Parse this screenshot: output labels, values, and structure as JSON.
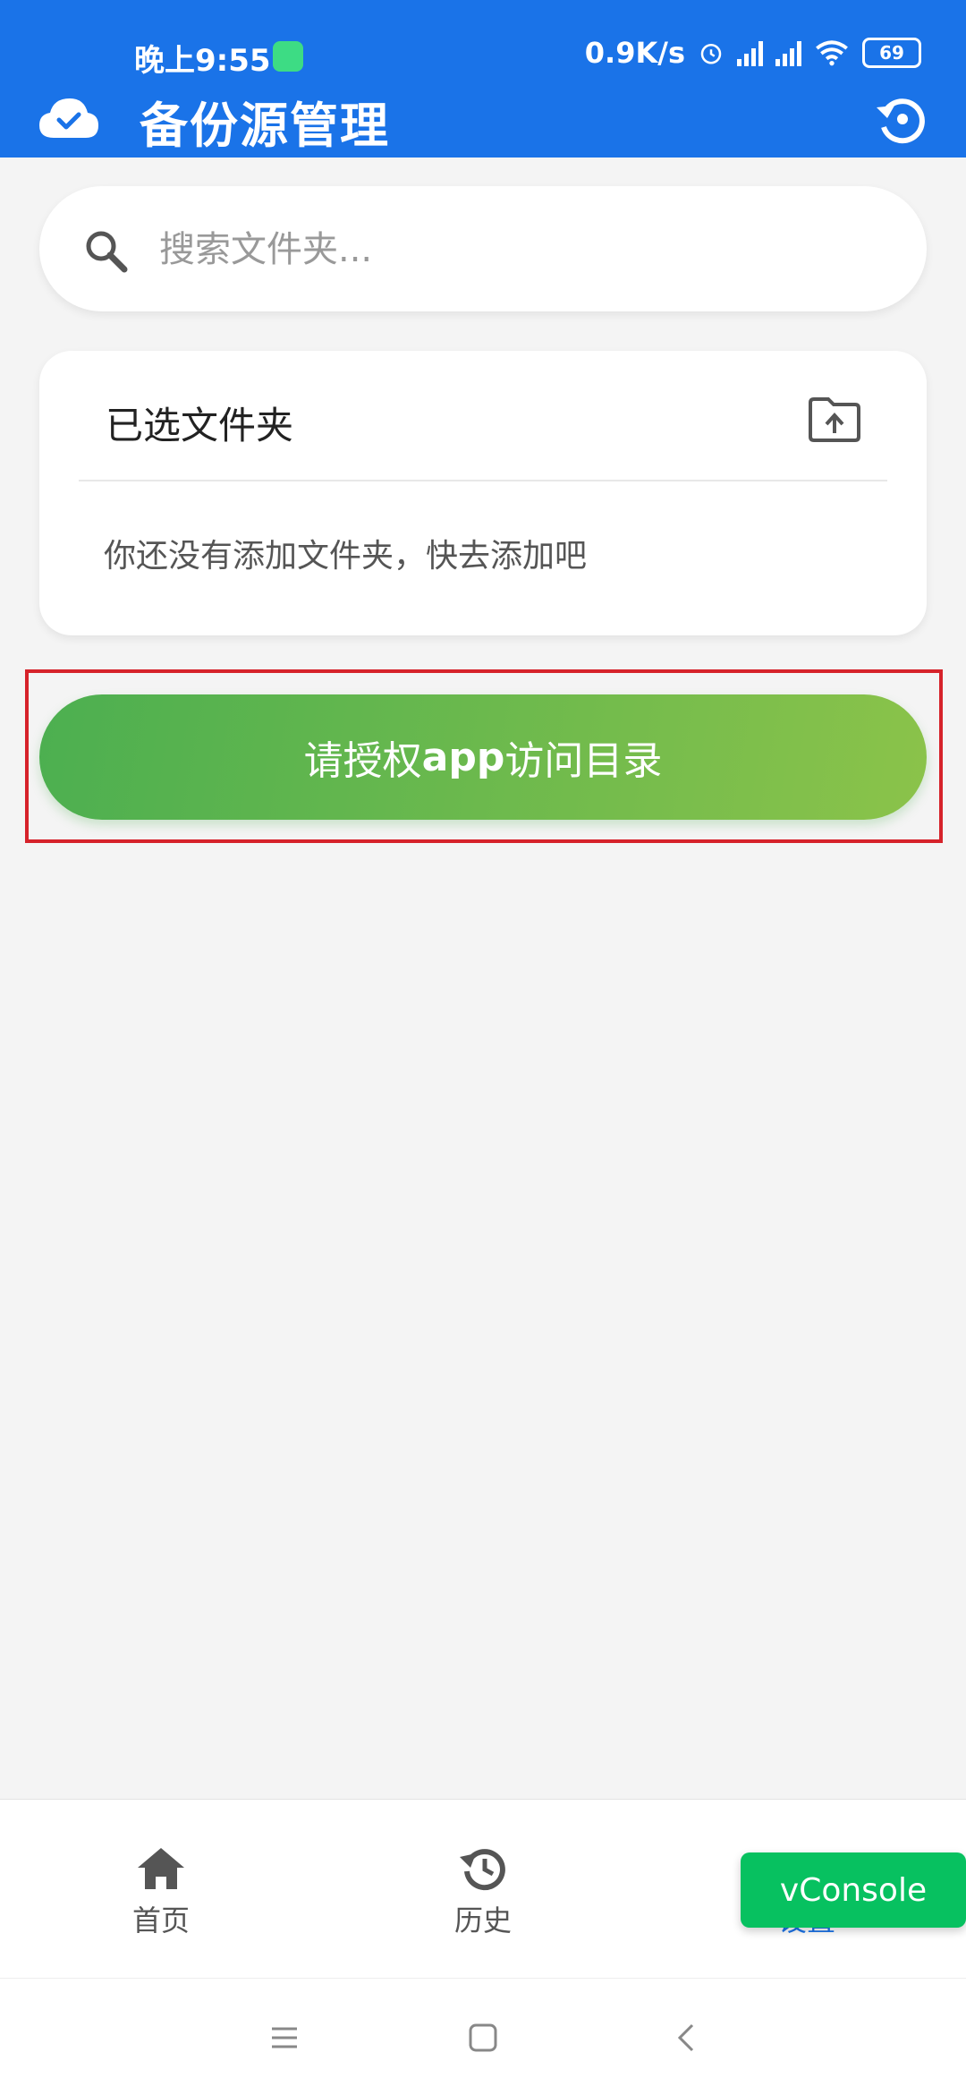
{
  "status_bar": {
    "time": "晚上9:55",
    "network_speed": "0.9K/s",
    "battery": "69"
  },
  "header": {
    "title": "备份源管理"
  },
  "search": {
    "placeholder": "搜索文件夹..."
  },
  "selected_folders": {
    "title": "已选文件夹",
    "empty_text": "你还没有添加文件夹，快去添加吧"
  },
  "grant_button": {
    "label_prefix": "请授权",
    "label_bold": "app",
    "label_suffix": "访问目录"
  },
  "bottom_nav": {
    "items": [
      {
        "label": "首页",
        "icon": "home-icon"
      },
      {
        "label": "历史",
        "icon": "history-icon"
      },
      {
        "label": "设置",
        "icon": "settings-icon"
      }
    ]
  },
  "vconsole": {
    "label": "vConsole"
  },
  "colors": {
    "primary": "#1a73e8",
    "button_gradient_start": "#4caf50",
    "button_gradient_end": "#8bc34a",
    "highlight": "#d6222a",
    "vconsole": "#07c160"
  }
}
